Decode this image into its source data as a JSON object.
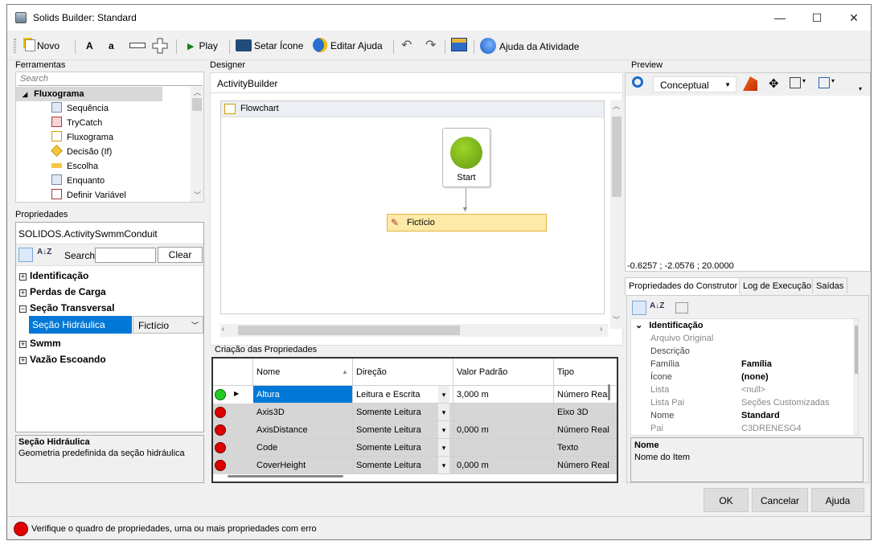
{
  "window": {
    "title": "Solids Builder: Standard",
    "minimize": "—",
    "maximize": "☐",
    "close": "✕"
  },
  "toolbar": {
    "new_label": "Novo",
    "font_large": "A",
    "font_small": "a",
    "play_label": "Play",
    "set_icon_label": "Setar Ícone",
    "edit_help_label": "Editar Ajuda",
    "activity_help_label": "Ajuda da Atividade"
  },
  "tools": {
    "title": "Ferramentas",
    "search_placeholder": "Search",
    "group": "Fluxograma",
    "items": [
      "Sequência",
      "TryCatch",
      "Fluxograma",
      "Decisão (If)",
      "Escolha",
      "Enquanto",
      "Definir Variável"
    ]
  },
  "properties": {
    "title": "Propriedades",
    "object": "SOLIDOS.ActivitySwmmConduit",
    "search_label": "Search:",
    "clear_label": "Clear",
    "groups": [
      {
        "label": "Identificação",
        "expanded": false
      },
      {
        "label": "Perdas de Carga",
        "expanded": false
      },
      {
        "label": "Seção Transversal",
        "expanded": true
      }
    ],
    "selected_key": "Seção Hidráulica",
    "selected_value": "Fictício",
    "groups_after": [
      {
        "label": "Swmm",
        "expanded": false
      },
      {
        "label": "Vazão Escoando",
        "expanded": false
      }
    ],
    "desc_title": "Seção Hidráulica",
    "desc_text": "Geometria predefinida da seção hidráulica"
  },
  "designer": {
    "title": "Designer",
    "breadcrumb": "ActivityBuilder",
    "flowchart_label": "Flowchart",
    "start_label": "Start",
    "node_label": "Fictício"
  },
  "creation": {
    "title": "Criação das Propriedades",
    "columns": [
      "Nome",
      "Direção",
      "Valor Padrão",
      "Tipo"
    ],
    "rows": [
      {
        "status": "#22cc22",
        "name": "Altura",
        "direction": "Leitura e Escrita",
        "default": "3,000 m",
        "type": "Número Real"
      },
      {
        "status": "#dd0000",
        "name": "Axis3D",
        "direction": "Somente Leitura",
        "default": "",
        "type": "Eixo 3D"
      },
      {
        "status": "#dd0000",
        "name": "AxisDistance",
        "direction": "Somente Leitura",
        "default": "0,000 m",
        "type": "Número Real"
      },
      {
        "status": "#dd0000",
        "name": "Code",
        "direction": "Somente Leitura",
        "default": "",
        "type": "Texto"
      },
      {
        "status": "#dd0000",
        "name": "CoverHeight",
        "direction": "Somente Leitura",
        "default": "0,000 m",
        "type": "Número Real"
      }
    ]
  },
  "preview": {
    "title": "Preview",
    "mode": "Conceptual",
    "coords": "-0.6257 ; -2.0576 ; 20.0000"
  },
  "builder_props": {
    "tabs": [
      "Propriedades do Construtor",
      "Log de Execução",
      "Saídas"
    ],
    "category": "Identificação",
    "rows": [
      {
        "key": "Arquivo Original",
        "value": "",
        "bold": false,
        "muted": true
      },
      {
        "key": "Descrição",
        "value": "",
        "bold": false,
        "muted": false
      },
      {
        "key": "Família",
        "value": "Família",
        "bold": true,
        "muted": false
      },
      {
        "key": "Ícone",
        "value": "(none)",
        "bold": true,
        "muted": false
      },
      {
        "key": "Lista",
        "value": "<null>",
        "bold": false,
        "muted": true
      },
      {
        "key": "Lista Pai",
        "value": "Seções Customizadas",
        "bold": false,
        "muted": true
      },
      {
        "key": "Nome",
        "value": "Standard",
        "bold": true,
        "muted": false
      },
      {
        "key": "Pai",
        "value": "C3DRENESG4",
        "bold": false,
        "muted": true
      }
    ],
    "desc_title": "Nome",
    "desc_text": "Nome do Item"
  },
  "buttons": {
    "ok": "OK",
    "cancel": "Cancelar",
    "help": "Ajuda"
  },
  "status": {
    "text": "Verifique o quadro de propriedades, uma ou mais propriedades com erro"
  }
}
